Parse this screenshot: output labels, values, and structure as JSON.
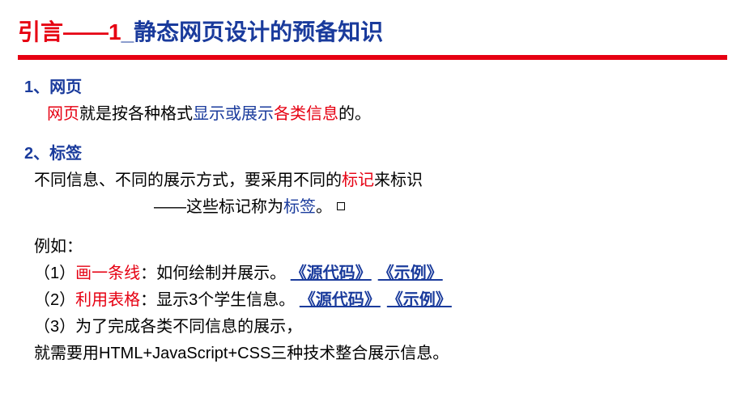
{
  "title": {
    "prefix": "引言——1",
    "underscore": "_",
    "rest": "静态网页设计的预备知识"
  },
  "sec1": {
    "heading": "1、网页",
    "line1_a": "网页",
    "line1_b": "就是按各种格式",
    "line1_c": "显示或展示",
    "line1_d": "各类信息",
    "line1_e": "的。"
  },
  "sec2": {
    "heading": "2、标签",
    "line1_a": "不同信息、不同的展示方式，要采用不同的",
    "line1_b": "标记",
    "line1_c": "来标识",
    "line2_a": "——这些标记称为",
    "line2_b": "标签",
    "line2_c": "。"
  },
  "examples": {
    "intro": "例如：",
    "item1_a": "（1）",
    "item1_b": "画一条线",
    "item1_c": "：如何绘制并展示。",
    "item2_a": "（2）",
    "item2_b": "利用表格",
    "item2_c": "：显示3个学生信息。",
    "item3": "（3）为了完成各类不同信息的展示，",
    "item3b": "就需要用HTML+JavaScript+CSS三种技术整合展示信息。",
    "link_source": "《源代码》",
    "link_demo": "《示例》"
  }
}
